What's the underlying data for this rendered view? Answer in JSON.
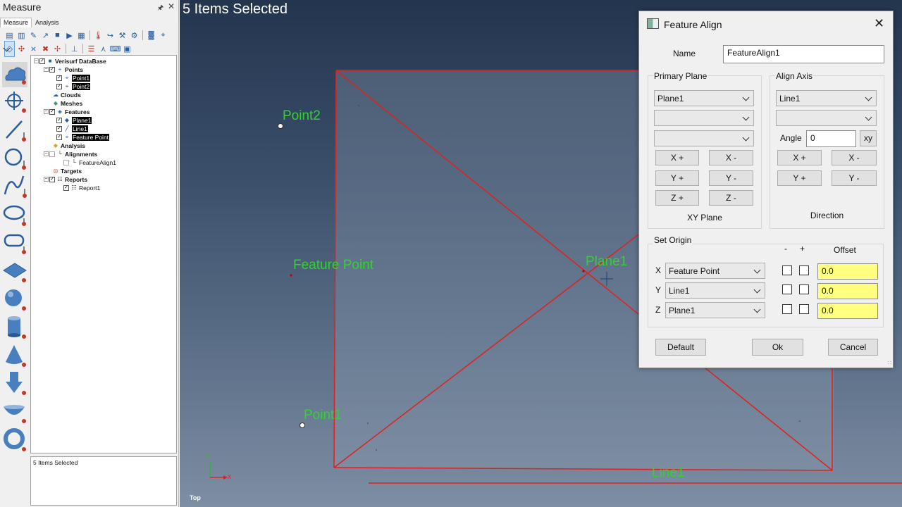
{
  "panel": {
    "title": "Measure",
    "tabs": [
      "Measure",
      "Analysis"
    ],
    "status": "5 Items Selected"
  },
  "tree": {
    "root": "Verisurf DataBase",
    "points": "Points",
    "point1": "Point1",
    "point2": "Point2",
    "clouds": "Clouds",
    "meshes": "Meshes",
    "features": "Features",
    "plane1": "Plane1",
    "line1": "Line1",
    "feature_point": "Feature Point",
    "analysis": "Analysis",
    "alignments": "Alignments",
    "featurealign1": "FeatureAlign1",
    "targets": "Targets",
    "reports": "Reports",
    "report1": "Report1"
  },
  "viewport": {
    "selected_text": "5 Items Selected",
    "labels": {
      "point2": "Point2",
      "feature_point": "Feature Point",
      "plane1": "Plane1",
      "point1": "Point1",
      "line1": "Line1"
    },
    "triad_y": "Y",
    "triad_x": "X",
    "view_name": "Top",
    "colors": {
      "geometry": "#e02020",
      "labels": "#31d231"
    }
  },
  "dialog": {
    "title": "Feature Align",
    "name_label": "Name",
    "name_value": "FeatureAlign1",
    "primary_plane_label": "Primary Plane",
    "primary_selects": [
      "Plane1",
      "",
      ""
    ],
    "primary_buttons": [
      "X +",
      "X -",
      "Y +",
      "Y -",
      "Z +",
      "Z -"
    ],
    "primary_footer": "XY Plane",
    "align_axis_label": "Align Axis",
    "align_selects": [
      "Line1",
      ""
    ],
    "angle_label": "Angle",
    "angle_value": "0",
    "xy_button": "xy",
    "align_buttons": [
      "X +",
      "X -",
      "Y +",
      "Y -"
    ],
    "align_footer": "Direction",
    "set_origin_label": "Set Origin",
    "minus_label": "-",
    "plus_label": "+",
    "offset_label": "Offset",
    "origin_rows": [
      {
        "axis": "X",
        "feature": "Feature Point",
        "offset": "0.0"
      },
      {
        "axis": "Y",
        "feature": "Line1",
        "offset": "0.0"
      },
      {
        "axis": "Z",
        "feature": "Plane1",
        "offset": "0.0"
      }
    ],
    "default_button": "Default",
    "ok_button": "Ok",
    "cancel_button": "Cancel"
  }
}
